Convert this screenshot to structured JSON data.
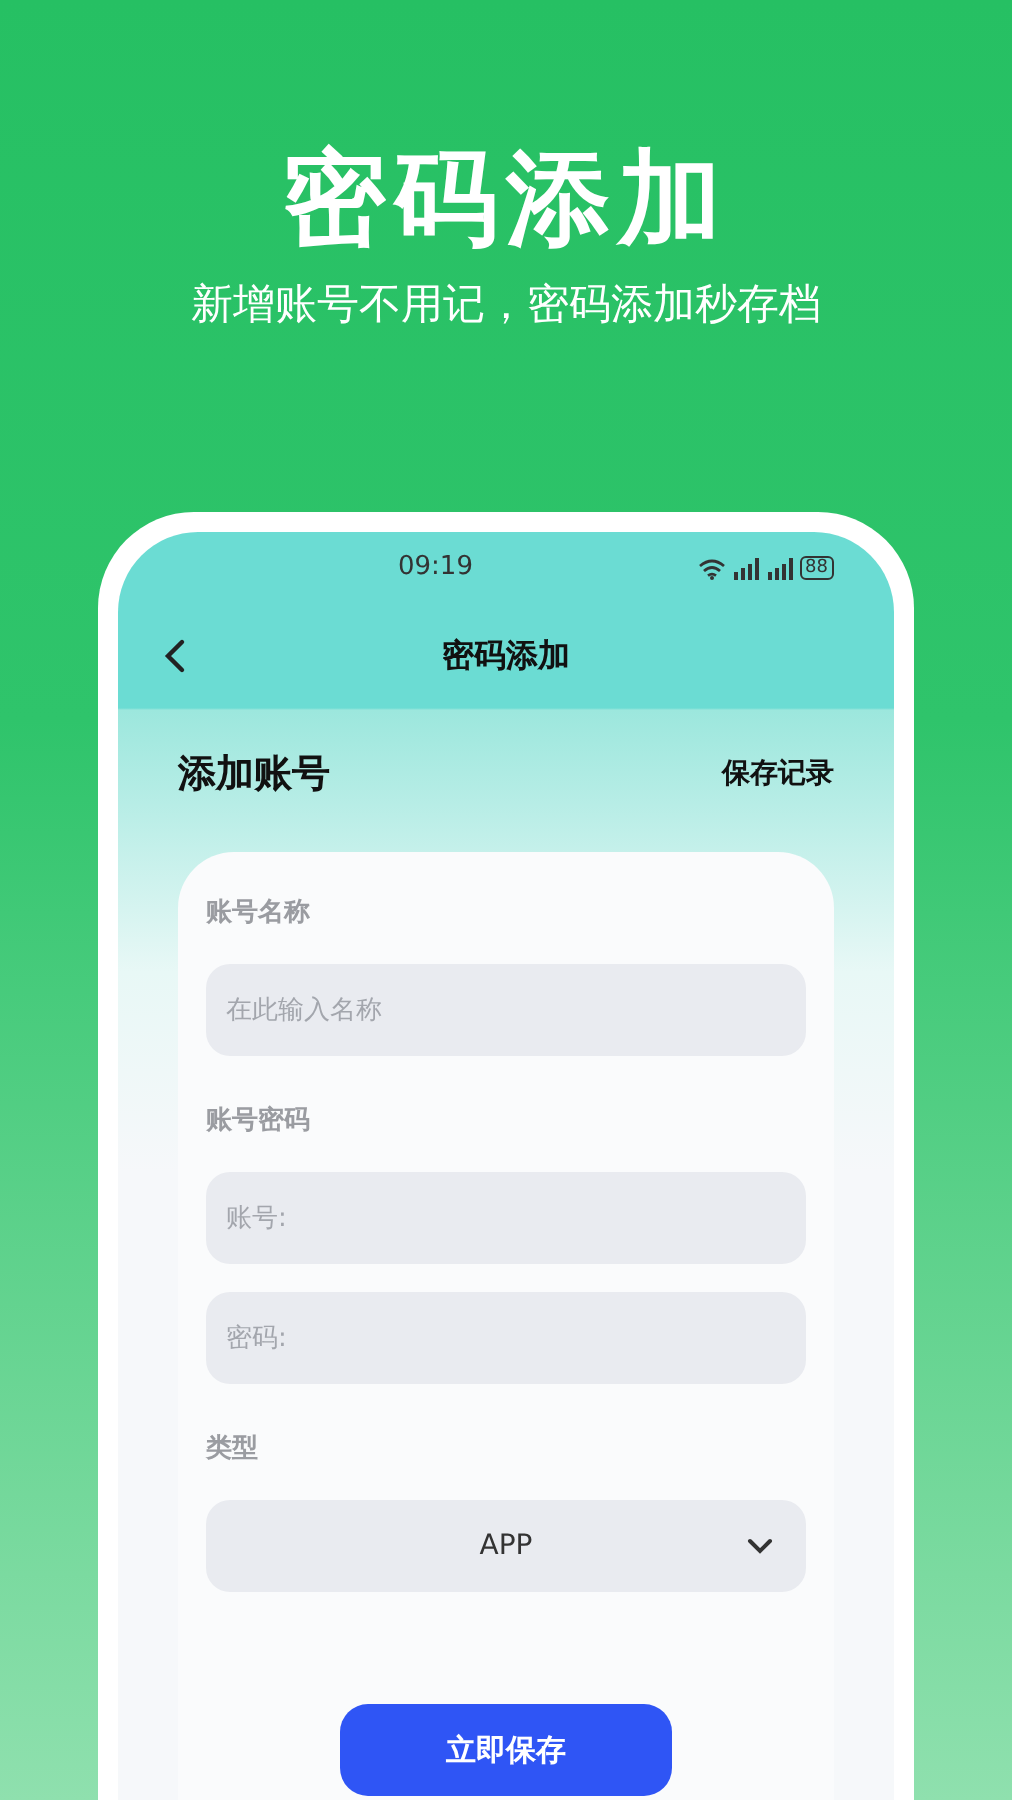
{
  "promo": {
    "headline": "密码添加",
    "tagline": "新增账号不用记，密码添加秒存档"
  },
  "status_bar": {
    "time": "09:19",
    "battery": "88"
  },
  "nav": {
    "title": "密码添加"
  },
  "section": {
    "title": "添加账号",
    "link": "保存记录"
  },
  "form": {
    "groups": [
      {
        "label": "账号名称",
        "fields": [
          {
            "kind": "text",
            "placeholder": "在此输入名称"
          }
        ]
      },
      {
        "label": "账号密码",
        "fields": [
          {
            "kind": "text",
            "placeholder": "账号:"
          },
          {
            "kind": "text",
            "placeholder": "密码:"
          }
        ]
      },
      {
        "label": "类型",
        "fields": [
          {
            "kind": "select",
            "value": "APP"
          }
        ]
      }
    ]
  },
  "save_button": "立即保存"
}
